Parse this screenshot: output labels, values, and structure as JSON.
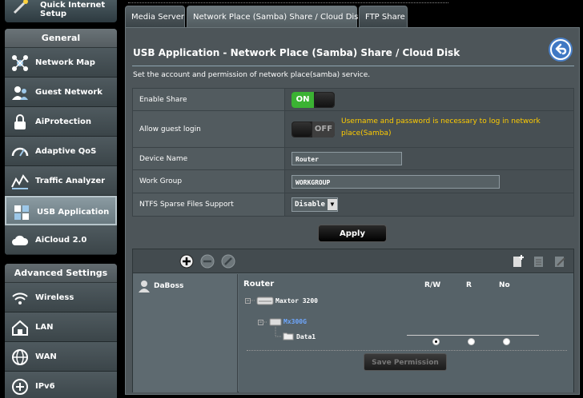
{
  "sidebar": {
    "qis_label": "Quick Internet Setup",
    "general_header": "General",
    "general_items": [
      {
        "label": "Network Map",
        "icon": "network-map-icon"
      },
      {
        "label": "Guest Network",
        "icon": "guest-network-icon"
      },
      {
        "label": "AiProtection",
        "icon": "lock-icon"
      },
      {
        "label": "Adaptive QoS",
        "icon": "gauge-icon"
      },
      {
        "label": "Traffic Analyzer",
        "icon": "chart-icon"
      },
      {
        "label": "USB Application",
        "icon": "puzzle-icon",
        "active": true
      },
      {
        "label": "AiCloud 2.0",
        "icon": "cloud-icon"
      }
    ],
    "advanced_header": "Advanced Settings",
    "advanced_items": [
      {
        "label": "Wireless",
        "icon": "wifi-icon"
      },
      {
        "label": "LAN",
        "icon": "home-icon"
      },
      {
        "label": "WAN",
        "icon": "globe-icon"
      },
      {
        "label": "IPv6",
        "icon": "ipv6-icon"
      }
    ]
  },
  "tabs": [
    {
      "label": "Media Server"
    },
    {
      "label": "Network Place (Samba) Share / Cloud Disk",
      "active": true
    },
    {
      "label": "FTP Share"
    }
  ],
  "page": {
    "title": "USB Application - Network Place (Samba) Share / Cloud Disk",
    "description": "Set the account and permission of network place(samba) service."
  },
  "form": {
    "enable_share": {
      "label": "Enable Share",
      "state": "ON"
    },
    "guest_login": {
      "label": "Allow guest login",
      "state": "OFF",
      "note": "Username and password is necessary to log in network place(Samba)"
    },
    "device_name": {
      "label": "Device Name",
      "value": "Router"
    },
    "work_group": {
      "label": "Work Group",
      "value": "WORKGROUP"
    },
    "ntfs_sparse": {
      "label": "NTFS Sparse Files Support",
      "value": "Disable"
    }
  },
  "apply_label": "Apply",
  "share": {
    "user": "DaBoss",
    "tree_root": "Router",
    "columns": [
      "R/W",
      "R",
      "No"
    ],
    "disk": "Maxtor 3200",
    "partition": "Mx300G",
    "folder": "Data1",
    "selected_permission": "R/W",
    "save_label": "Save Permission"
  },
  "colors": {
    "on_green": "#3bb233",
    "warning": "#ffcc00",
    "panel_bg": "#4d5559"
  }
}
